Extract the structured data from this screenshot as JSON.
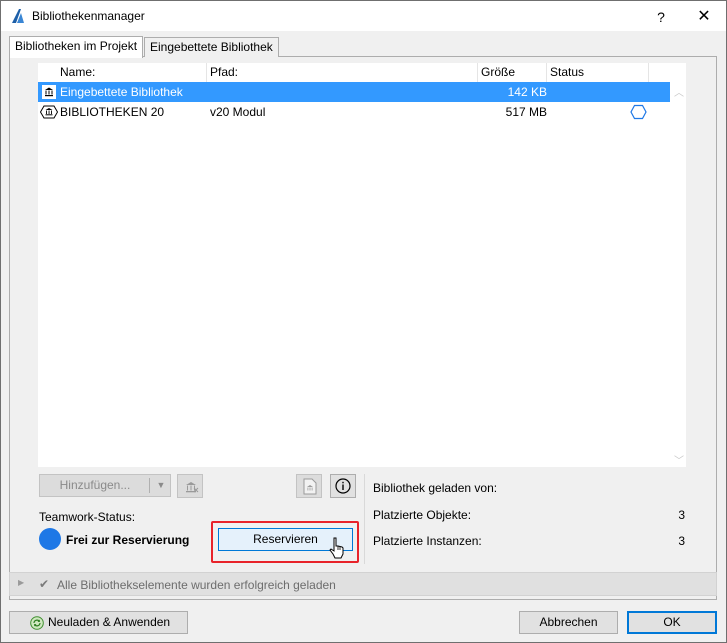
{
  "window": {
    "title": "Bibliothekenmanager",
    "help": "?",
    "close": "✕"
  },
  "tabs": [
    {
      "label": "Bibliotheken im Projekt",
      "active": true
    },
    {
      "label": "Eingebettete Bibliothek",
      "active": false
    }
  ],
  "list": {
    "columns": [
      "Name:",
      "Pfad:",
      "Größe",
      "Status"
    ],
    "rows": [
      {
        "name": "Eingebettete Bibliothek",
        "path": "",
        "size": "142 KB",
        "status": "",
        "selected": true,
        "icon": "embedded-library-icon"
      },
      {
        "name": "BIBLIOTHEKEN 20",
        "path": "v20 Modul",
        "size": "517 MB",
        "status": "hexagon-status-icon",
        "selected": false,
        "icon": "library-icon"
      }
    ]
  },
  "toolbar": {
    "add_label": "Hinzufügen...",
    "add_arrow": "▼"
  },
  "teamwork": {
    "label": "Teamwork-Status:",
    "status": "Frei zur Reservierung",
    "reserve_label": "Reservieren",
    "status_color": "#1e78e6"
  },
  "info": {
    "loaded_from_label": "Bibliothek geladen von:",
    "placed_objects_label": "Platzierte Objekte:",
    "placed_objects_value": "3",
    "placed_instances_label": "Platzierte Instanzen:",
    "placed_instances_value": "3"
  },
  "statusbar": {
    "message": "Alle Bibliothekselemente wurden erfolgreich geladen"
  },
  "buttons": {
    "reload": "Neuladen & Anwenden",
    "cancel": "Abbrechen",
    "ok": "OK"
  },
  "colors": {
    "selection": "#3399ff",
    "highlight_border": "#e8232a",
    "accent": "#0078d7"
  }
}
